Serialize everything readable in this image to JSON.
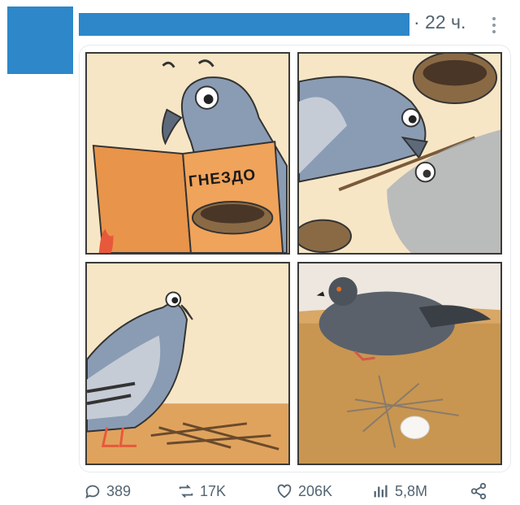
{
  "post": {
    "time": "· 22 ч.",
    "comic": {
      "book_title": "ГНЕЗДО"
    }
  },
  "actions": {
    "replies": "389",
    "reposts": "17K",
    "likes": "206K",
    "views": "5,8M"
  },
  "icons": [
    "more-vertical-icon",
    "reply-icon",
    "repost-icon",
    "like-icon",
    "views-icon",
    "share-icon"
  ],
  "colors": {
    "placeholder_blue": "#2d87c8",
    "text_muted": "#536471",
    "panel_background": "#f7e6c5"
  }
}
